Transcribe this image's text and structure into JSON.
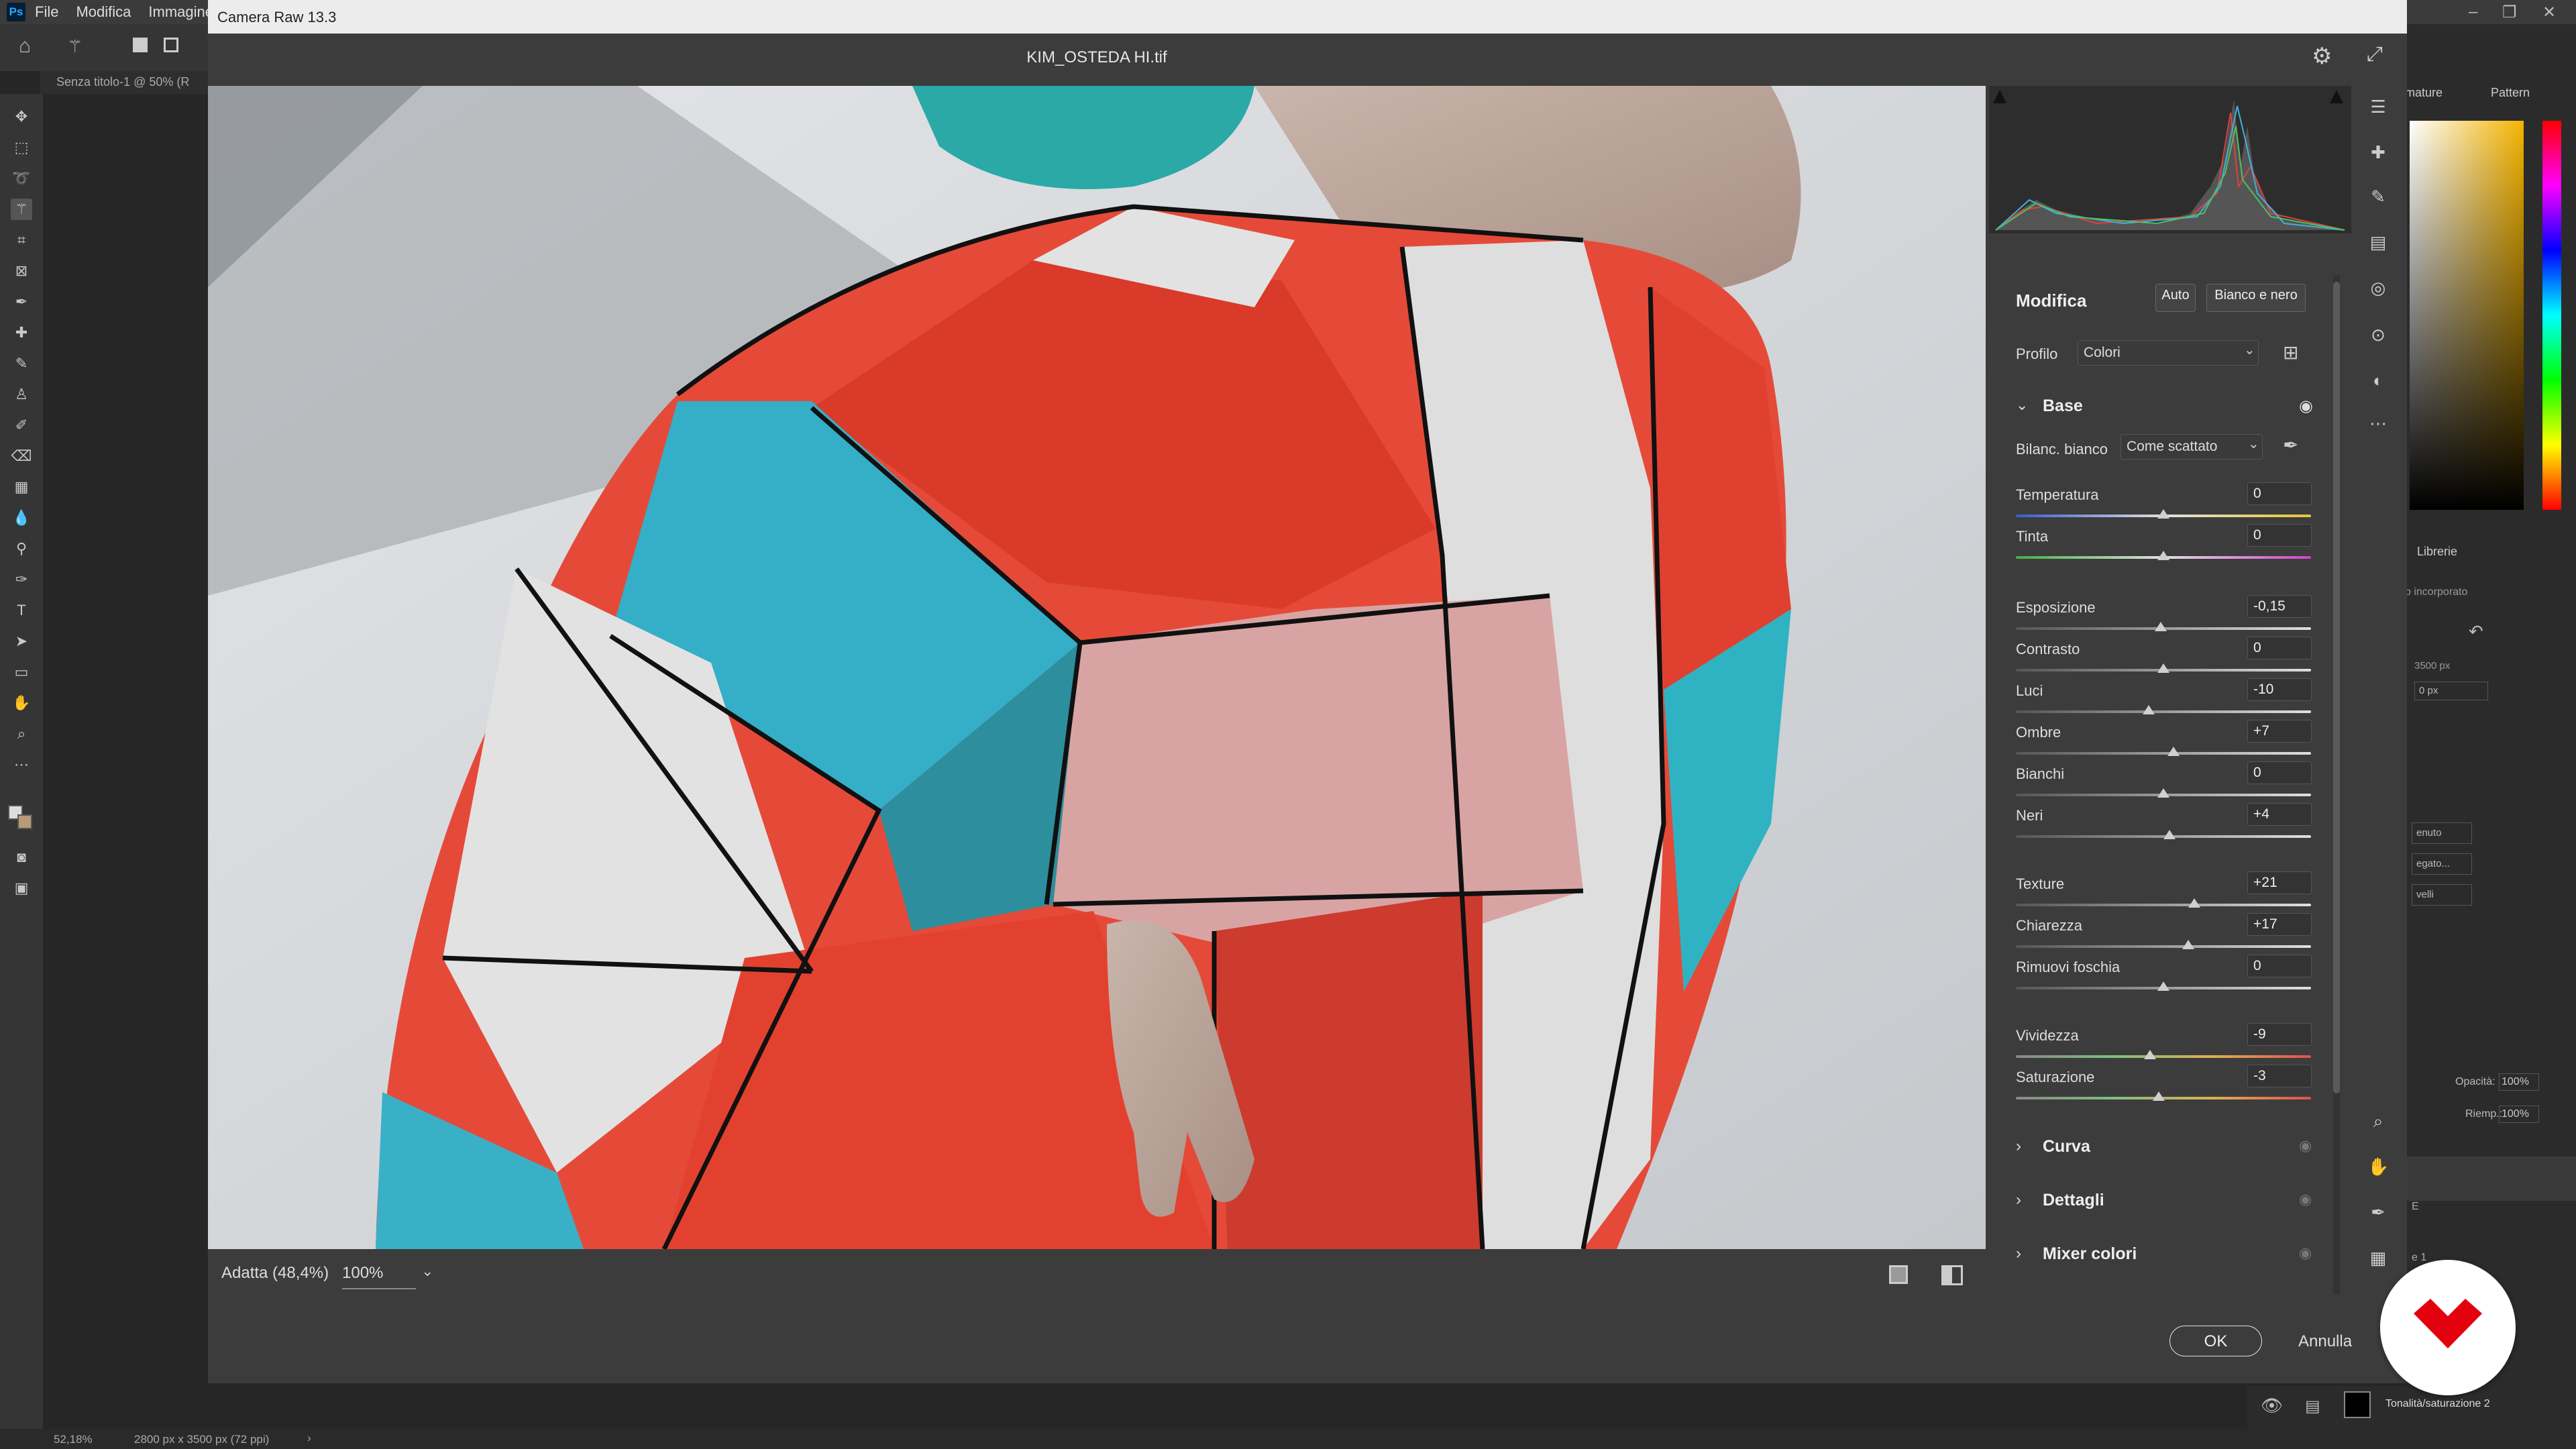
{
  "photoshop": {
    "logo": "Ps",
    "menu": [
      "File",
      "Modifica",
      "Immagine"
    ],
    "doc_tab": "Senza titolo-1 @ 50% (R",
    "status_zoom": "52,18%",
    "status_size": "2800 px x 3500 px (72 ppi)",
    "status_arrow": "›",
    "panel_tabs": {
      "sfumature": "mature",
      "pattern": "Pattern",
      "librerie": "Librerie"
    },
    "properties": {
      "embedded": "o incorporato",
      "width": "3500 px",
      "offset": "0 px"
    },
    "layers_buttons": [
      "enuto",
      "egato...",
      "velli"
    ],
    "opacity_label": "Opacità:",
    "opacity_value": "100%",
    "fill_label": "Riemp.:",
    "fill_value": "100%",
    "layer_name": "Tonalità/saturazione 2",
    "extra": {
      "e": "E",
      "e1": "e 1"
    }
  },
  "camera_raw": {
    "title": "Camera Raw 13.3",
    "filename": "KIM_OSTEDA HI.tif",
    "zoom_fit": "Adatta (48,4%)",
    "zoom_pct": "100%",
    "ok": "OK",
    "cancel": "Annulla",
    "edit": {
      "heading": "Modifica",
      "auto": "Auto",
      "bw": "Bianco e nero",
      "profile_label": "Profilo",
      "profile_value": "Colori",
      "base": "Base",
      "wb_label": "Bilanc. bianco",
      "wb_value": "Come scattato",
      "sliders": [
        {
          "label": "Temperatura",
          "value": "0",
          "pos": 0.5
        },
        {
          "label": "Tinta",
          "value": "0",
          "pos": 0.5
        },
        {
          "label": "Esposizione",
          "value": "-0,15",
          "pos": 0.49
        },
        {
          "label": "Contrasto",
          "value": "0",
          "pos": 0.5
        },
        {
          "label": "Luci",
          "value": "-10",
          "pos": 0.45
        },
        {
          "label": "Ombre",
          "value": "+7",
          "pos": 0.535
        },
        {
          "label": "Bianchi",
          "value": "0",
          "pos": 0.5
        },
        {
          "label": "Neri",
          "value": "+4",
          "pos": 0.52
        },
        {
          "label": "Texture",
          "value": "+21",
          "pos": 0.605
        },
        {
          "label": "Chiarezza",
          "value": "+17",
          "pos": 0.585
        },
        {
          "label": "Rimuovi foschia",
          "value": "0",
          "pos": 0.5
        },
        {
          "label": "Vividezza",
          "value": "-9",
          "pos": 0.455
        },
        {
          "label": "Saturazione",
          "value": "-3",
          "pos": 0.485
        }
      ],
      "sections": [
        "Curva",
        "Dettagli",
        "Mixer colori"
      ]
    }
  },
  "colors": {
    "accent_red": "#e3000f"
  }
}
